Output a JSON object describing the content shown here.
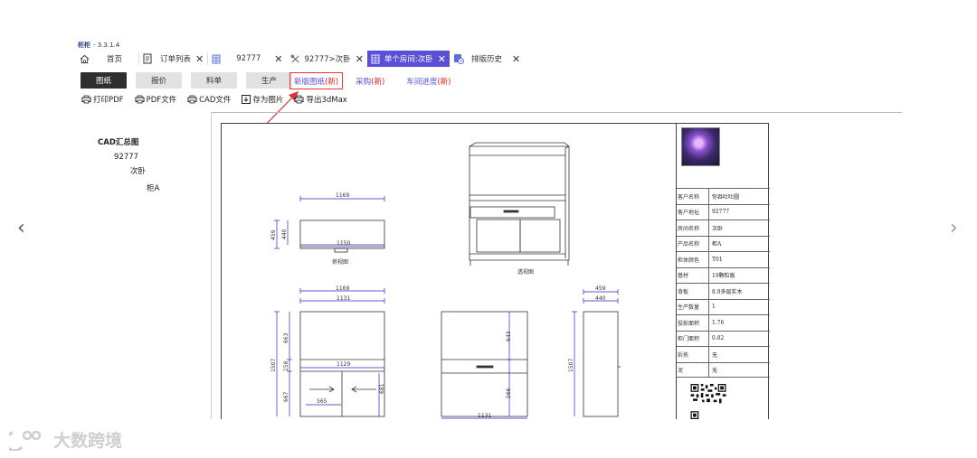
{
  "app": {
    "brand": "柜柜",
    "version": "- 3.3.1.4"
  },
  "tabs": [
    {
      "label": "首页",
      "icon": "home-icon",
      "closable": false,
      "active": false
    },
    {
      "label": "订单列表",
      "icon": "document-icon",
      "closable": true,
      "active": false
    },
    {
      "label": "92777",
      "icon": "grid-icon",
      "closable": true,
      "active": false
    },
    {
      "label": "92777>次卧",
      "icon": "tools-icon",
      "closable": true,
      "active": false
    },
    {
      "label": "单个房间:次卧",
      "icon": "grid-icon",
      "closable": true,
      "active": true
    },
    {
      "label": "排版历史",
      "icon": "history-icon",
      "closable": true,
      "active": false
    }
  ],
  "segments": [
    {
      "label": "图纸",
      "active": true
    },
    {
      "label": "报价",
      "active": false
    },
    {
      "label": "料单",
      "active": false
    },
    {
      "label": "生产",
      "active": false
    }
  ],
  "links": [
    {
      "label": "新版图纸",
      "tag": "(新)",
      "highlighted": true
    },
    {
      "label": "采购",
      "tag": "(新)",
      "highlighted": false
    },
    {
      "label": "车间进度",
      "tag": "(新)",
      "highlighted": false
    }
  ],
  "toolbar": [
    {
      "label": "打印PDF",
      "icon": "print-icon"
    },
    {
      "label": "PDF文件",
      "icon": "pdf-icon"
    },
    {
      "label": "CAD文件",
      "icon": "cad-icon"
    },
    {
      "label": "存为图片",
      "icon": "save-image-icon"
    },
    {
      "label": "导出3dMax",
      "icon": "export-icon"
    }
  ],
  "tree": [
    {
      "label": "CAD汇总图",
      "level": 0
    },
    {
      "label": "92777",
      "level": 1
    },
    {
      "label": "次卧",
      "level": 2
    },
    {
      "label": "柜A",
      "level": 3
    }
  ],
  "nav": {
    "prev": "‹",
    "next": "›"
  },
  "drawing": {
    "views": {
      "top_view": "俯视图",
      "perspective": "透视图"
    },
    "dims": {
      "d1169a": "1169",
      "d1150": "1150",
      "d459a": "459",
      "d440a": "440",
      "d1169b": "1169",
      "d1131a": "1131",
      "d459b": "459",
      "d440b": "440",
      "d1507a": "1507",
      "d663a": "663",
      "d158": "158",
      "d667": "667",
      "d1129": "1129",
      "d565": "565",
      "d681": "681",
      "d643": "643",
      "d566": "566",
      "d1131b": "1131",
      "d1507b": "1507"
    }
  },
  "info": {
    "rows": [
      {
        "key": "客户名称",
        "value": "你吞吐吐圆"
      },
      {
        "key": "客户地址",
        "value": "92777"
      },
      {
        "key": "房间名称",
        "value": "次卧"
      },
      {
        "key": "产品名称",
        "value": "柜A"
      },
      {
        "key": "柜体颜色",
        "value": "T01"
      },
      {
        "key": "基材",
        "value": "19颗粒板"
      },
      {
        "key": "背板",
        "value": "8.9多层实木"
      },
      {
        "key": "生产数量",
        "value": "1"
      },
      {
        "key": "投影面积",
        "value": "1.76"
      },
      {
        "key": "柜门面积",
        "value": "0.82"
      },
      {
        "key": "拆拣",
        "value": "无"
      },
      {
        "key": "泥",
        "value": "无"
      }
    ]
  },
  "watermark": {
    "text": "大数跨境"
  }
}
